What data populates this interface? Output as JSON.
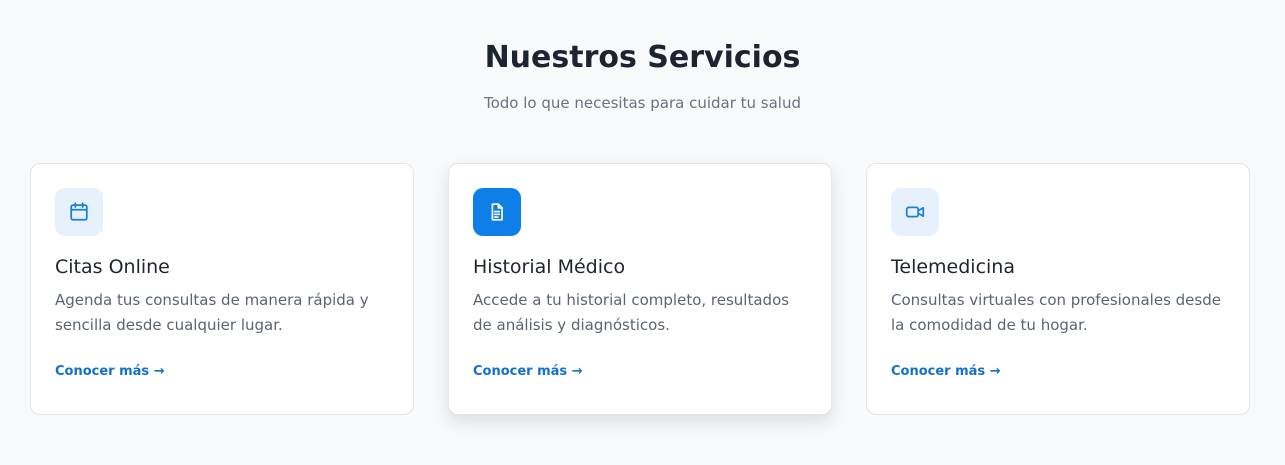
{
  "header": {
    "title": "Nuestros Servicios",
    "subtitle": "Todo lo que necesitas para cuidar tu salud"
  },
  "services": [
    {
      "icon": "calendar-icon",
      "title": "Citas Online",
      "description": "Agenda tus consultas de manera rápida y sencilla desde cualquier lugar.",
      "link": "Conocer más →"
    },
    {
      "icon": "document-icon",
      "title": "Historial Médico",
      "description": "Accede a tu historial completo, resultados de análisis y diagnósticos.",
      "link": "Conocer más →"
    },
    {
      "icon": "video-camera-icon",
      "title": "Telemedicina",
      "description": "Consultas virtuales con profesionales desde la comodidad de tu hogar.",
      "link": "Conocer más →"
    }
  ],
  "colors": {
    "background": "#f8f9fb",
    "accent": "#0f7fe8",
    "accent_light": "#e6f1fc",
    "link": "#1371c9",
    "heading": "#1d2330",
    "muted": "#6b7280"
  }
}
